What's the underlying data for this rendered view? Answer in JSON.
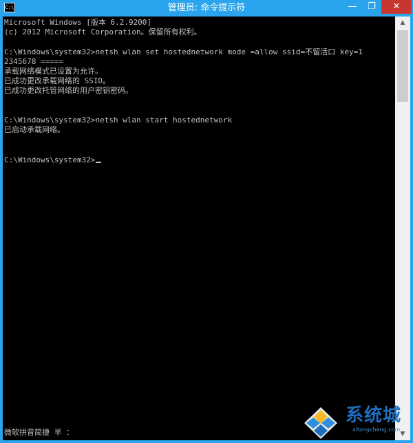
{
  "titlebar": {
    "title": "管理员: 命令提示符",
    "app_icon_text": "C:\\",
    "buttons": {
      "minimize": "—",
      "maximize": "❐",
      "close": "✕"
    }
  },
  "console": {
    "lines": [
      "Microsoft Windows [版本 6.2.9200]",
      "(c) 2012 Microsoft Corporation。保留所有权利。",
      "",
      "C:\\Windows\\system32>netsh wlan set hostednetwork mode =allow ssid=不留活口 key=1",
      "2345678 =====",
      "承载网络模式已设置为允许。",
      "已成功更改承载网络的 SSID。",
      "已成功更改托管网络的用户密钥密码。",
      "",
      "",
      "C:\\Windows\\system32>netsh wlan start hostednetwork",
      "已启动承载网络。",
      "",
      "",
      "",
      "C:\\Windows\\system32>"
    ]
  },
  "ime": {
    "status": "微软拼音简捷 半 ："
  },
  "scrollbar": {
    "up": "▲",
    "down": "▼"
  },
  "watermark": {
    "brand": "系统城",
    "url": "xitongcheng.com"
  },
  "colors": {
    "accent": "#2aa4ec",
    "console_bg": "#000000",
    "console_text": "#c0c0c0",
    "close_button": "#c7372f"
  }
}
